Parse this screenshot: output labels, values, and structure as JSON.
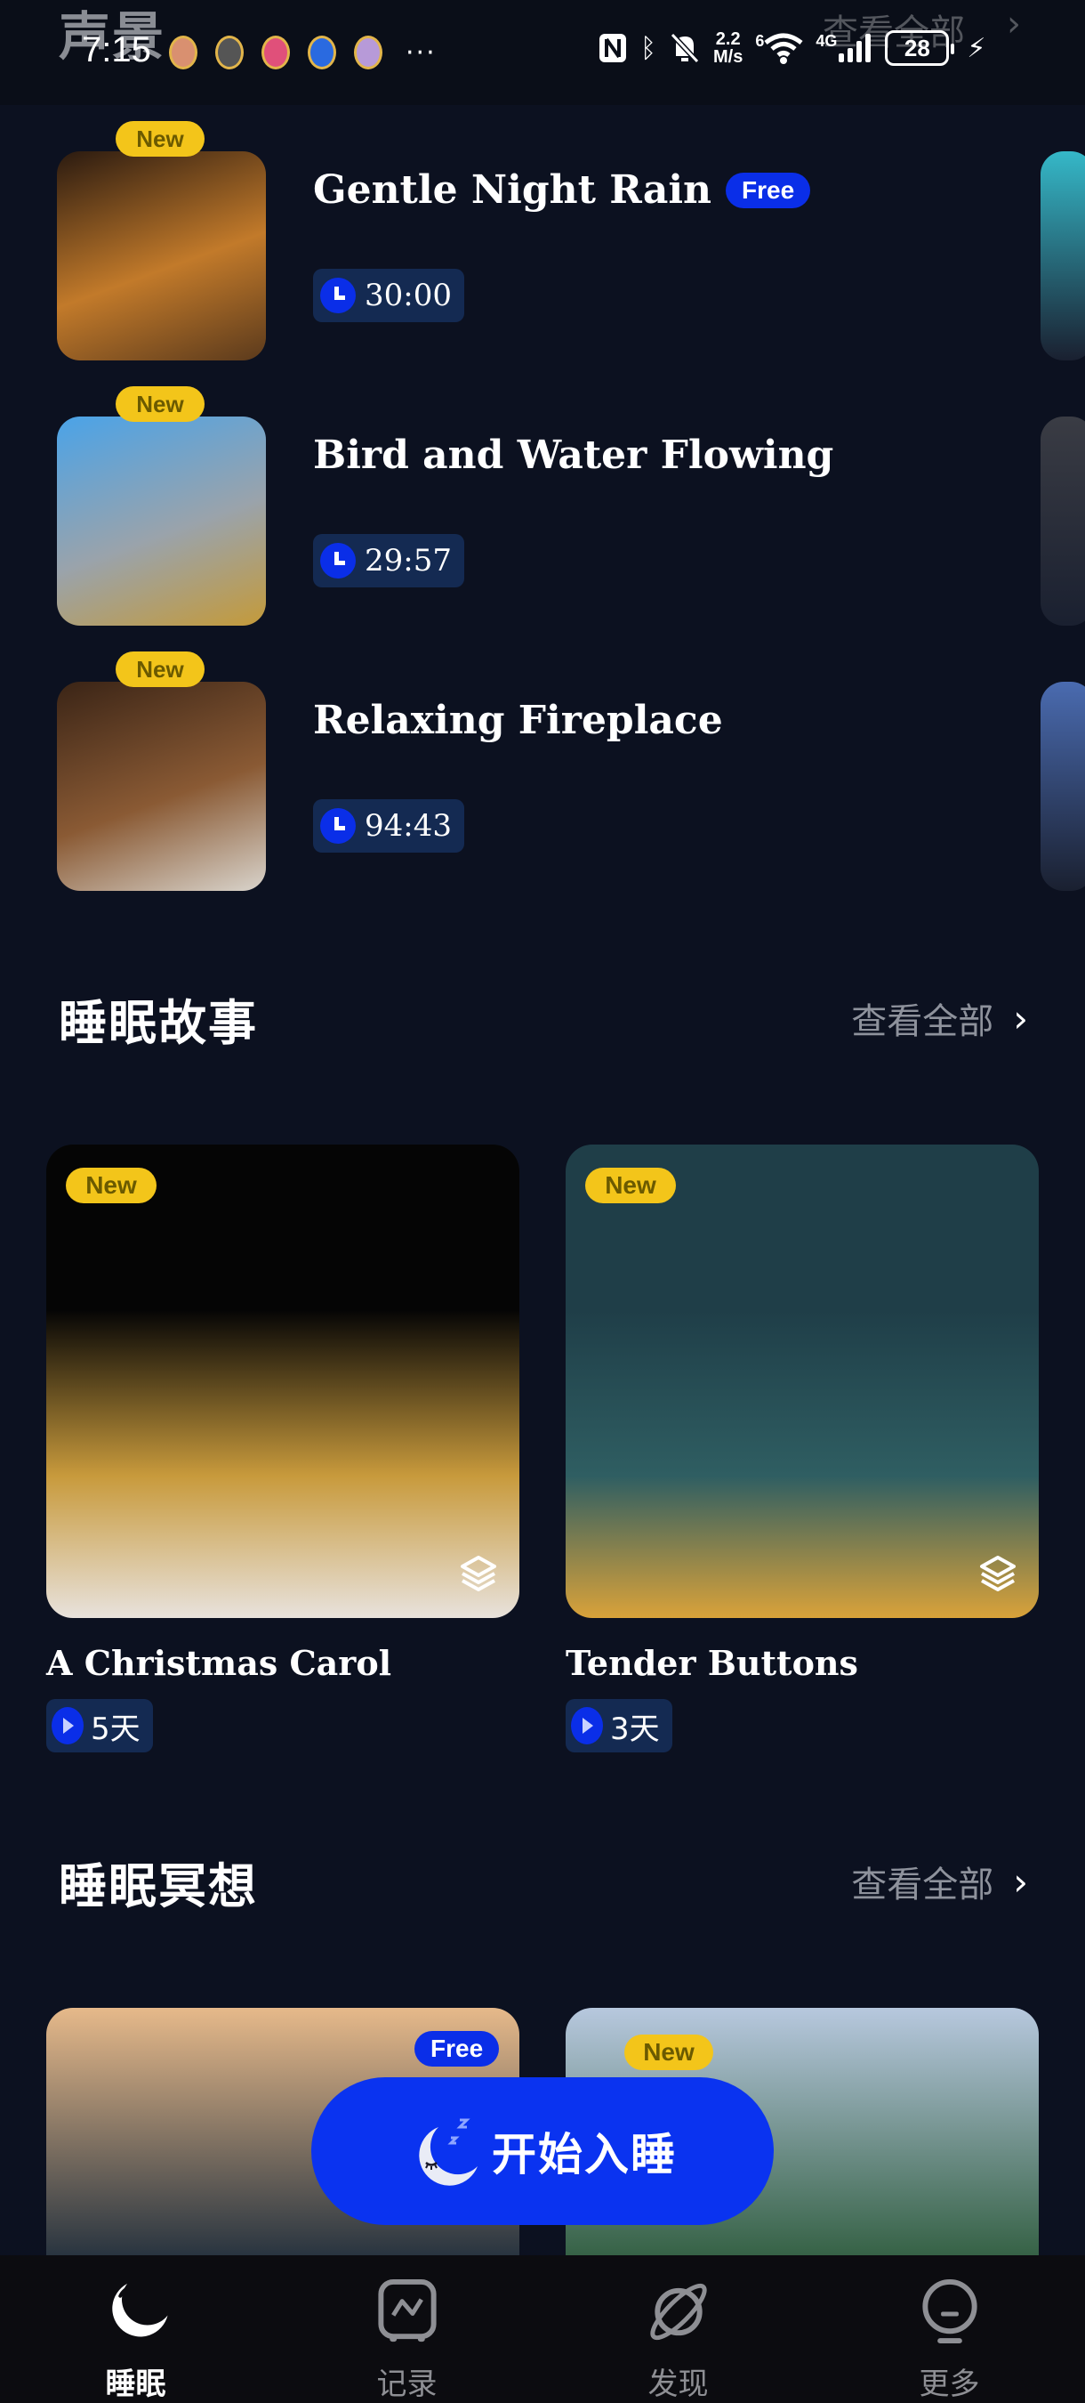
{
  "status_bar": {
    "time": "7:15",
    "notification_icons": [
      "app-hand-icon",
      "app-penguin-icon",
      "app-pink-icon",
      "app-blue-icon",
      "app-mic-icon"
    ],
    "more_notifications": "···",
    "network_speed_value": "2.2",
    "network_speed_unit": "M/s",
    "wifi_label": "6",
    "cell_label": "4G",
    "battery_level": "28"
  },
  "ghost_header": {
    "title": "声景",
    "view_all": "查看全部",
    "chevron": "›"
  },
  "soundscapes": [
    {
      "title": "Gentle Night Rain",
      "badge": "New",
      "free_label": "Free",
      "duration": "30:00",
      "colors": [
        "#2a1a10",
        "#c27a2a",
        "#5b3a1c"
      ]
    },
    {
      "title": "Bird and Water Flowing",
      "badge": "New",
      "free_label": "",
      "duration": "29:57",
      "colors": [
        "#4aa3e8",
        "#9aa3ab",
        "#c49a3a"
      ]
    },
    {
      "title": "Relaxing Fireplace",
      "badge": "New",
      "free_label": "",
      "duration": "94:43",
      "colors": [
        "#3a2416",
        "#8a5a34",
        "#d9d4cc"
      ]
    }
  ],
  "peek_colors": [
    "#35b8c8",
    "#3a3c44",
    "#4a6bb0"
  ],
  "sections": {
    "stories": {
      "title": "睡眠故事",
      "view_all": "查看全部",
      "chevron": "›"
    },
    "meditation": {
      "title": "睡眠冥想",
      "view_all": "查看全部",
      "chevron": "›"
    }
  },
  "stories": [
    {
      "title": "A Christmas Carol",
      "badge": "New",
      "days": "5天",
      "colors": [
        "#050505",
        "#c89a3c",
        "#e8e2dc"
      ]
    },
    {
      "title": "Tender Buttons",
      "badge": "New",
      "days": "3天",
      "colors": [
        "#1f3e48",
        "#2f5e62",
        "#d9a23a"
      ]
    }
  ],
  "meditations": [
    {
      "badge": "Free",
      "colors": [
        "#e6b98a",
        "#1a2a3a"
      ]
    },
    {
      "badge": "New",
      "colors": [
        "#b7c8de",
        "#2c5a3a"
      ]
    }
  ],
  "start_sleep": {
    "label": "开始入睡"
  },
  "bottom_nav": [
    {
      "label": "睡眠",
      "icon": "moon-icon",
      "active": true
    },
    {
      "label": "记录",
      "icon": "chart-icon",
      "active": false
    },
    {
      "label": "发现",
      "icon": "planet-icon",
      "active": false
    },
    {
      "label": "更多",
      "icon": "more-icon",
      "active": false
    }
  ],
  "colors": {
    "background": "#0c1120",
    "accent_blue": "#0a33f0",
    "new_badge": "#f3c51a",
    "chip_bg": "#142a52",
    "muted_text": "#8e929c"
  }
}
